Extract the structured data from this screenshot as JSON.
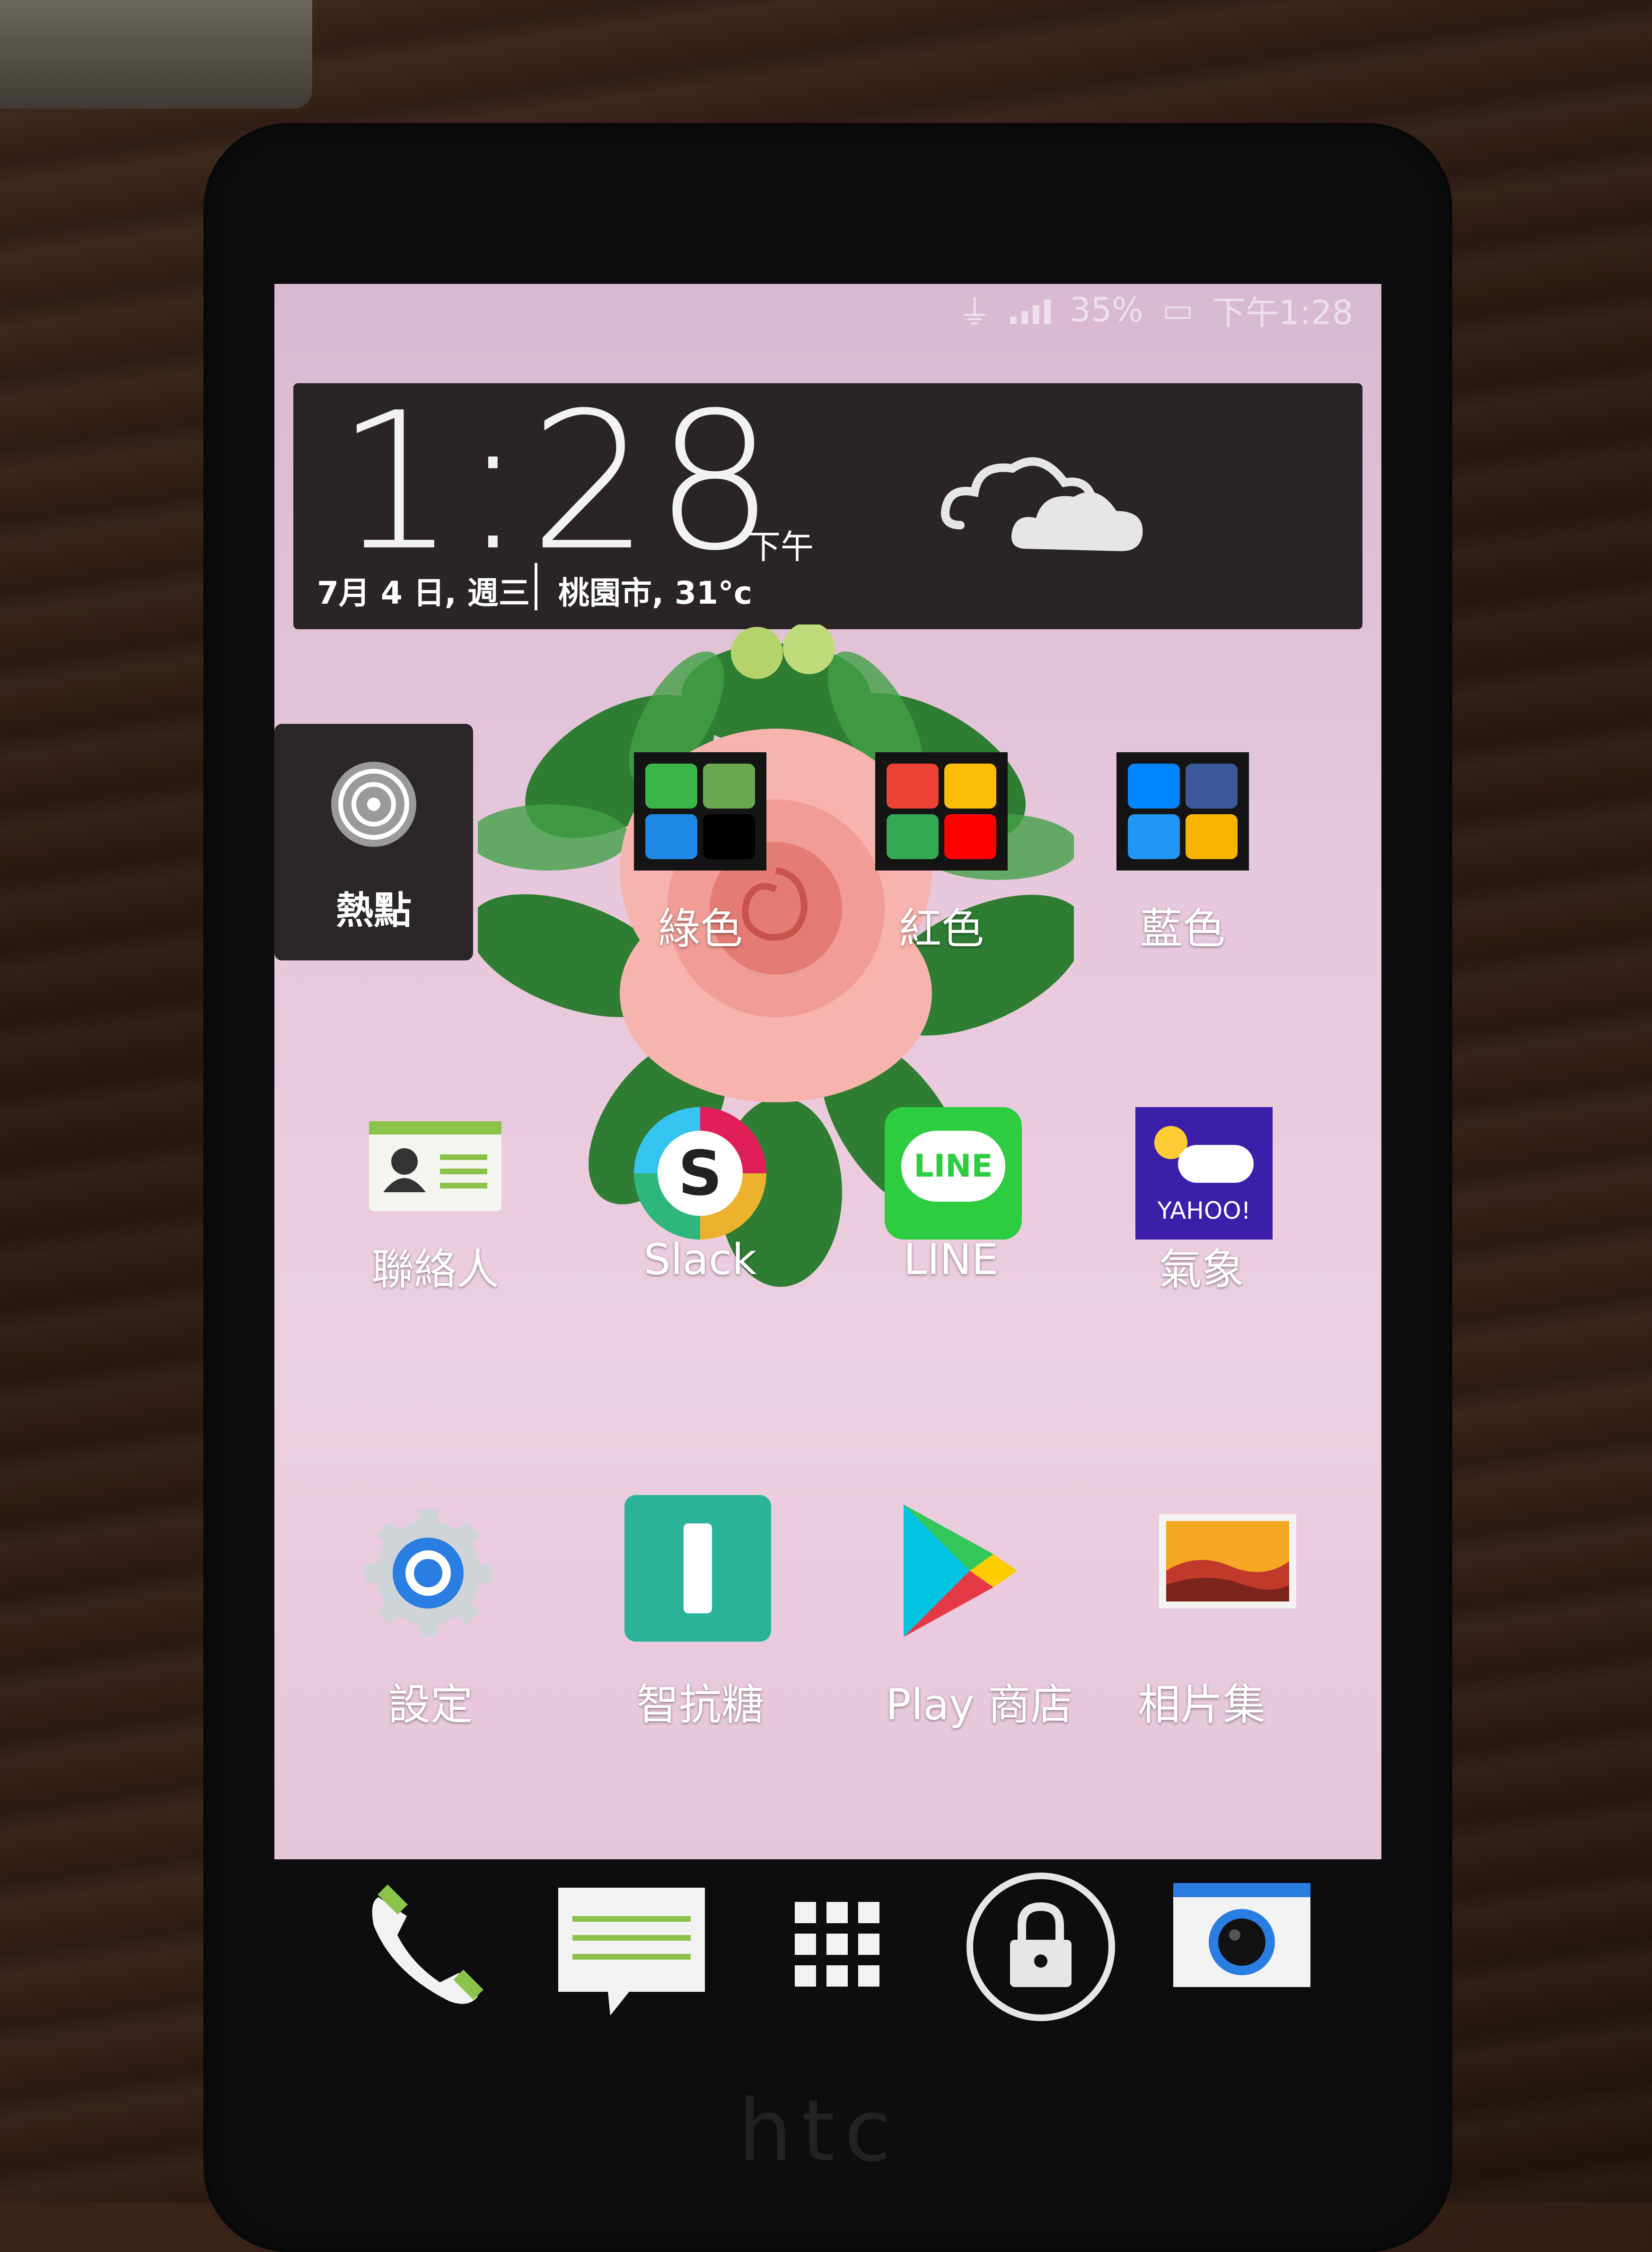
{
  "status_bar": {
    "battery": "35%",
    "time": "下午1:28"
  },
  "clock_widget": {
    "time": "1:28",
    "ampm": "下午",
    "date": "7月 4 日, 週三",
    "location_temp": "桃園市, 31°c",
    "weather_icon": "cloudy-icon"
  },
  "home": {
    "hotspot": {
      "label": "熱點",
      "icon": "hotspot-icon"
    },
    "folders": [
      {
        "label": "綠色",
        "colors": [
          "#39b54a",
          "#6aa84f",
          "#1e88e5",
          "#000000"
        ]
      },
      {
        "label": "紅色",
        "colors": [
          "#ea4335",
          "#fbbc05",
          "#34a853",
          "#ff0000"
        ]
      },
      {
        "label": "藍色",
        "colors": [
          "#0084ff",
          "#3b5998",
          "#2196f3",
          "#f4b400"
        ]
      }
    ],
    "row2": [
      {
        "label": "聯絡人",
        "icon": "contacts-icon"
      },
      {
        "label": "Slack",
        "icon": "slack-icon"
      },
      {
        "label": "LINE",
        "icon": "line-icon"
      },
      {
        "label": "氣象",
        "icon": "yahoo-weather-icon",
        "badge": "YAHOO!"
      }
    ],
    "row3": [
      {
        "label": "設定",
        "icon": "settings-gear-icon"
      },
      {
        "label": "智抗糖",
        "icon": "zhikangtang-icon"
      },
      {
        "label": "Play 商店",
        "icon": "play-store-icon"
      },
      {
        "label": "相片集",
        "icon": "gallery-icon"
      }
    ]
  },
  "line_icon_text": "LINE",
  "slack_icon_text": "S",
  "dock": [
    {
      "name": "phone-icon"
    },
    {
      "name": "messages-icon"
    },
    {
      "name": "app-drawer-icon"
    },
    {
      "name": "lock-icon"
    },
    {
      "name": "camera-icon"
    }
  ],
  "brand": "htc"
}
